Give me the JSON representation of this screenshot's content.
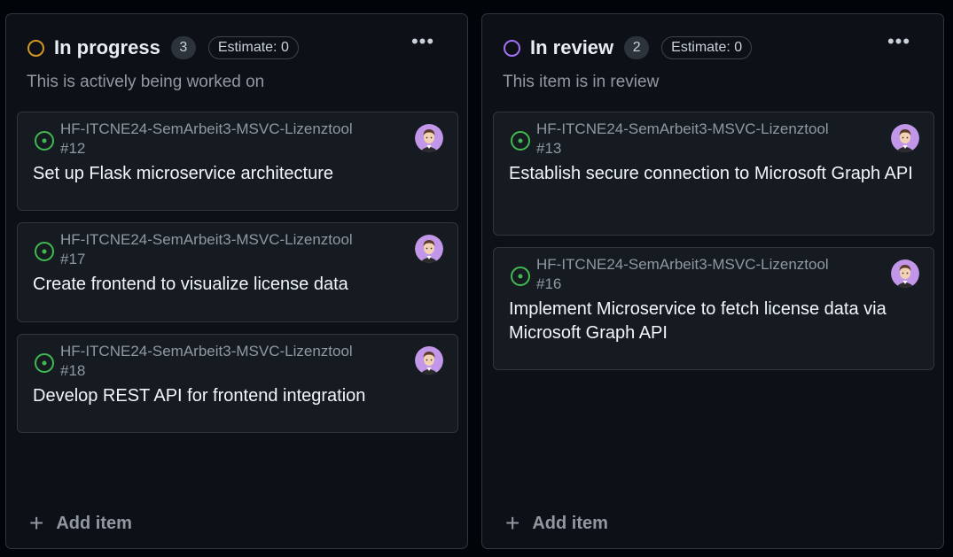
{
  "columns": [
    {
      "title": "In progress",
      "count": "3",
      "estimate": "Estimate: 0",
      "description": "This is actively being worked on",
      "status_color": "#d29922",
      "add_item_label": "Add item",
      "cards": [
        {
          "repo": "HF-ITCNE24-SemArbeit3-MSVC-Lizenztool",
          "number": "#12",
          "title": "Set up Flask microservice architecture"
        },
        {
          "repo": "HF-ITCNE24-SemArbeit3-MSVC-Lizenztool",
          "number": "#17",
          "title": "Create frontend to visualize license data"
        },
        {
          "repo": "HF-ITCNE24-SemArbeit3-MSVC-Lizenztool",
          "number": "#18",
          "title": "Develop REST API for frontend integration"
        }
      ]
    },
    {
      "title": "In review",
      "count": "2",
      "estimate": "Estimate: 0",
      "description": "This item is in review",
      "status_color": "#a371f7",
      "add_item_label": "Add item",
      "cards": [
        {
          "repo": "HF-ITCNE24-SemArbeit3-MSVC-Lizenztool",
          "number": "#13",
          "title": "Establish secure connection to Microsoft Graph API"
        },
        {
          "repo": "HF-ITCNE24-SemArbeit3-MSVC-Lizenztool",
          "number": "#16",
          "title": "Implement Microservice to fetch license data via Microsoft Graph API"
        }
      ]
    }
  ],
  "icons": {
    "status": "circle-outline-icon",
    "issue": "open-issue-icon",
    "menu": "kebab-menu-icon",
    "add": "plus-icon",
    "avatar": "user-avatar"
  },
  "colors": {
    "issue_open": "#3fb950",
    "avatar_bg": "#c297e9"
  }
}
